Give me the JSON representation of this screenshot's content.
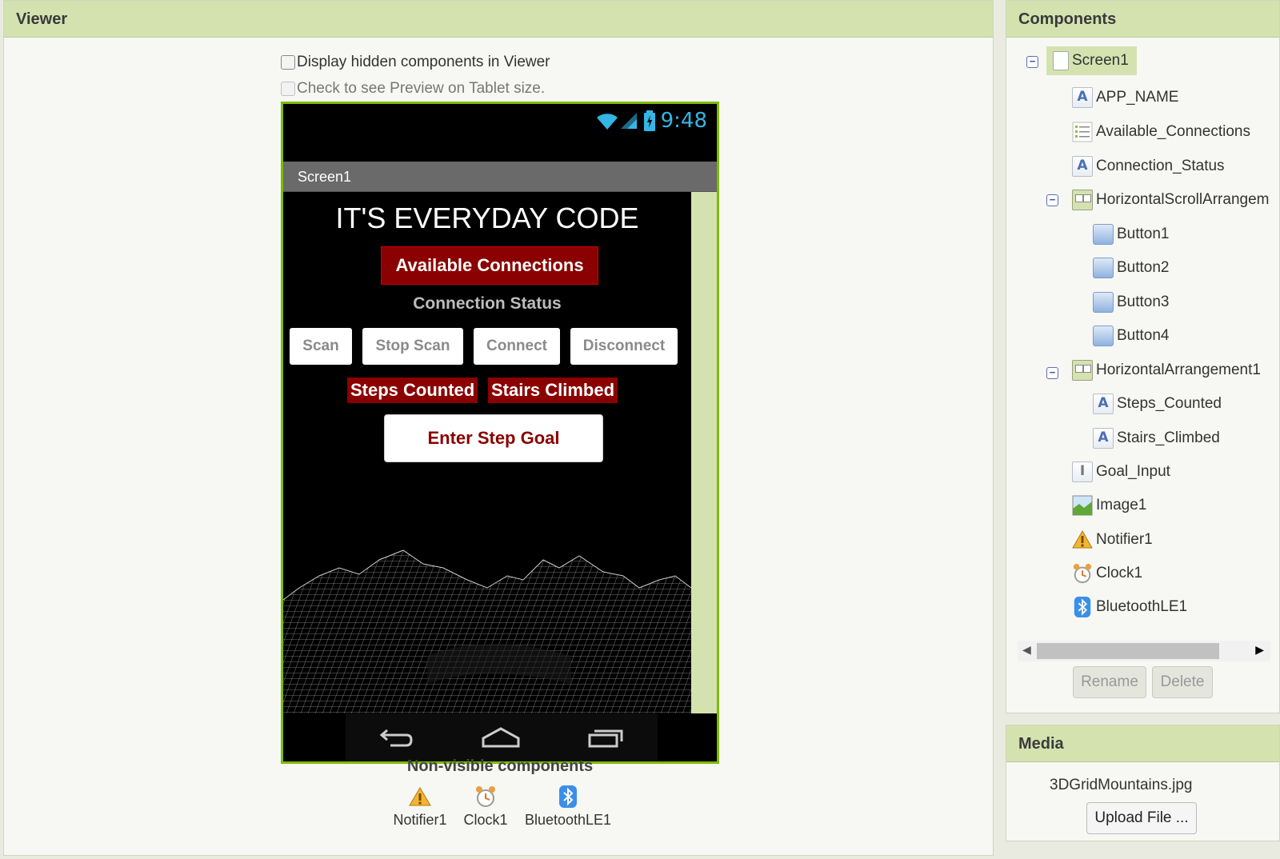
{
  "viewer": {
    "title": "Viewer",
    "checkbox_hidden": "Display hidden components in Viewer",
    "checkbox_tablet": "Check to see Preview on Tablet size.",
    "status_time": "9:48",
    "screen_title": "Screen1",
    "app_name": "IT'S EVERYDAY CODE",
    "available_connections": "Available Connections",
    "connection_status": "Connection Status",
    "buttons": [
      "Scan",
      "Stop Scan",
      "Connect",
      "Disconnect"
    ],
    "steps_counted": "Steps Counted",
    "stairs_climbed": "Stairs Climbed",
    "goal_button": "Enter Step Goal",
    "nonvisible_title": "Non-visible components",
    "nonvisible": [
      {
        "label": "Notifier1",
        "icon": "warning-icon"
      },
      {
        "label": "Clock1",
        "icon": "alarm-clock-icon"
      },
      {
        "label": "BluetoothLE1",
        "icon": "bluetooth-icon"
      }
    ]
  },
  "components": {
    "title": "Components",
    "tree": [
      {
        "label": "Screen1",
        "icon": "screen-icon",
        "selected": true
      },
      {
        "label": "APP_NAME",
        "icon": "label-icon"
      },
      {
        "label": "Available_Connections",
        "icon": "listview-icon"
      },
      {
        "label": "Connection_Status",
        "icon": "label-icon"
      },
      {
        "label": "HorizontalScrollArrangem",
        "icon": "arrangement-icon"
      },
      {
        "label": "Button1",
        "icon": "button-icon"
      },
      {
        "label": "Button2",
        "icon": "button-icon"
      },
      {
        "label": "Button3",
        "icon": "button-icon"
      },
      {
        "label": "Button4",
        "icon": "button-icon"
      },
      {
        "label": "HorizontalArrangement1",
        "icon": "arrangement-icon"
      },
      {
        "label": "Steps_Counted",
        "icon": "label-icon"
      },
      {
        "label": "Stairs_Climbed",
        "icon": "label-icon"
      },
      {
        "label": "Goal_Input",
        "icon": "textbox-icon"
      },
      {
        "label": "Image1",
        "icon": "image-icon"
      },
      {
        "label": "Notifier1",
        "icon": "warning-icon"
      },
      {
        "label": "Clock1",
        "icon": "alarm-clock-icon"
      },
      {
        "label": "BluetoothLE1",
        "icon": "bluetooth-icon"
      }
    ],
    "rename": "Rename",
    "delete": "Delete"
  },
  "media": {
    "title": "Media",
    "file": "3DGridMountains.jpg",
    "upload": "Upload File ..."
  },
  "colors": {
    "header": "#d4e2b0",
    "phone_border": "#7fba00",
    "dark_red": "#8b0000",
    "status_blue": "#33b5e5"
  }
}
